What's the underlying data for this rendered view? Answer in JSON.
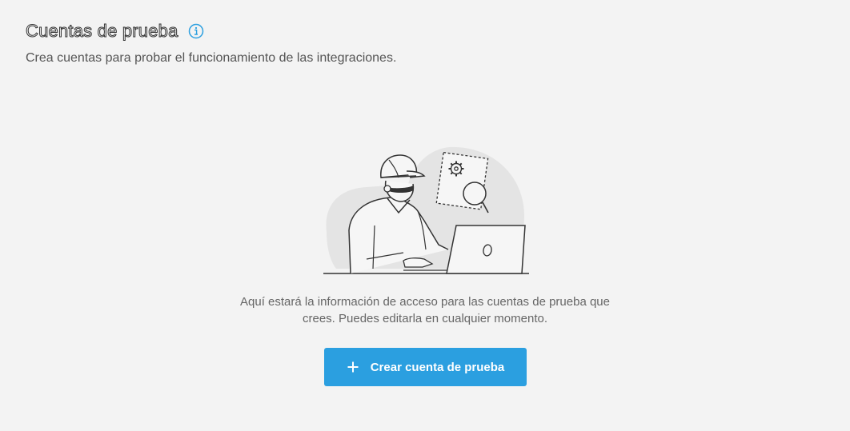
{
  "header": {
    "title": "Cuentas de prueba",
    "info_icon": "info-circle-icon",
    "subtitle": "Crea cuentas para probar el funcionamiento de las integraciones."
  },
  "empty_state": {
    "illustration": "person-with-laptop-illustration",
    "text_line_1": "Aquí estará la información de acceso para las cuentas de prueba que",
    "text_line_2": "crees. Puedes editarla en cualquier momento.",
    "button": {
      "icon": "plus-icon",
      "label": "Crear cuenta de prueba"
    }
  },
  "colors": {
    "background": "#f3f3f3",
    "accent": "#2b9fe0",
    "info_icon": "#2b9fe0"
  }
}
